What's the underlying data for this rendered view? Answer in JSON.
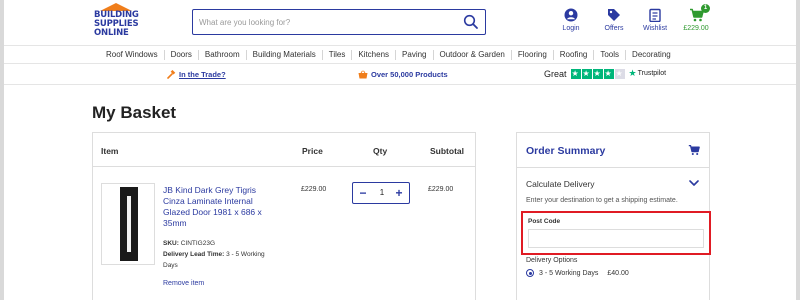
{
  "header": {
    "logo_lines": [
      "BUILDING",
      "SUPPLIES",
      "ONLINE"
    ],
    "search_placeholder": "What are you looking for?",
    "icons": [
      {
        "name": "login-icon",
        "label": "Login"
      },
      {
        "name": "offers-icon",
        "label": "Offers"
      },
      {
        "name": "wishlist-icon",
        "label": "Wishlist"
      },
      {
        "name": "cart-icon",
        "label": "£229.00",
        "badge": "1"
      }
    ]
  },
  "nav": {
    "items": [
      "Roof Windows",
      "Doors",
      "Bathroom",
      "Building Materials",
      "Tiles",
      "Kitchens",
      "Paving",
      "Outdoor & Garden",
      "Flooring",
      "Roofing",
      "Tools",
      "Decorating"
    ]
  },
  "promo": {
    "trade": "In the Trade?",
    "products": "Over 50,000 Products",
    "rating_word": "Great",
    "trustpilot": "Trustpilot",
    "stars_filled": 4,
    "stars_total": 5
  },
  "page": {
    "title": "My Basket"
  },
  "basket": {
    "headers": {
      "item": "Item",
      "price": "Price",
      "qty": "Qty",
      "subtotal": "Subtotal"
    },
    "product": {
      "name": "JB Kind Dark Grey Tigris Cinza Laminate Internal Glazed Door 1981 x 686 x 35mm",
      "sku_label": "SKU:",
      "sku": "CINTIG23G",
      "lead_label": "Delivery Lead Time:",
      "lead": "3 - 5 Working Days",
      "price": "£229.00",
      "qty": "1",
      "minus": "−",
      "plus": "+",
      "subtotal": "£229.00",
      "remove": "Remove item"
    }
  },
  "summary": {
    "title": "Order Summary",
    "calc_title": "Calculate Delivery",
    "calc_desc": "Enter your destination to get a shipping estimate.",
    "postcode_label": "Post Code",
    "postcode_value": "",
    "delivery_title": "Delivery Options",
    "option_label": "3 - 5 Working Days",
    "option_price": "£40.00"
  },
  "colors": {
    "brand_blue": "#2b3aa0",
    "brand_orange": "#f07e1b",
    "cart_green": "#2f9a2f",
    "highlight_red": "#e01b24",
    "trustpilot_green": "#00b67a"
  }
}
